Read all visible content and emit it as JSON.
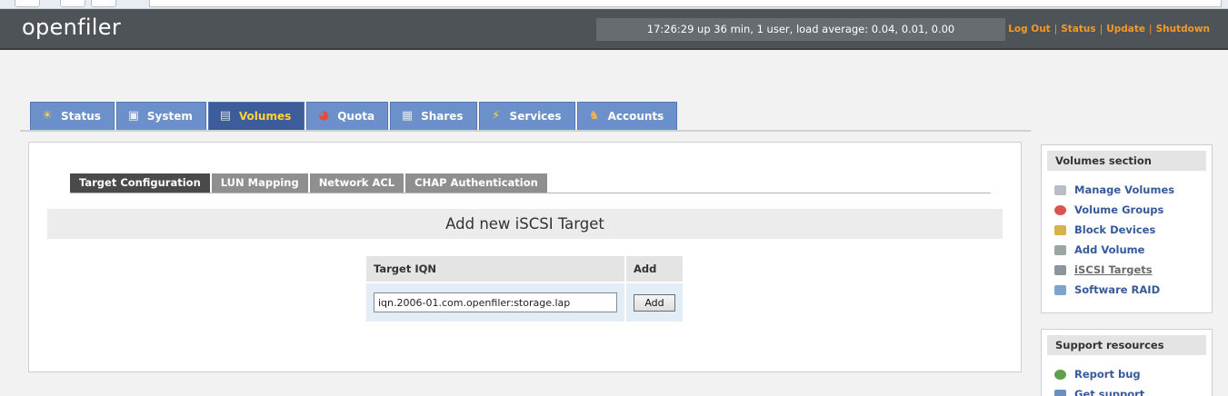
{
  "header": {
    "logo": "openfiler",
    "uptime": "17:26:29 up 36 min, 1 user, load average: 0.04, 0.01, 0.00",
    "links": [
      "Log Out",
      "Status",
      "Update",
      "Shutdown"
    ]
  },
  "tabs": [
    {
      "label": "Status",
      "icon": "sun-icon"
    },
    {
      "label": "System",
      "icon": "monitor-icon"
    },
    {
      "label": "Volumes",
      "icon": "disk-icon",
      "active": true
    },
    {
      "label": "Quota",
      "icon": "pie-icon"
    },
    {
      "label": "Shares",
      "icon": "folder-icon"
    },
    {
      "label": "Services",
      "icon": "lightning-icon"
    },
    {
      "label": "Accounts",
      "icon": "users-icon"
    }
  ],
  "subtabs": [
    "Target Configuration",
    "LUN Mapping",
    "Network ACL",
    "CHAP Authentication"
  ],
  "main": {
    "title": "Add new iSCSI Target",
    "table": {
      "col_iqn": "Target IQN",
      "col_add": "Add",
      "iqn_value": "iqn.2006-01.com.openfiler:storage.lap",
      "add_label": "Add"
    }
  },
  "volumes_section": {
    "title": "Volumes section",
    "items": [
      {
        "label": "Manage Volumes",
        "icon": "manage-volumes-icon"
      },
      {
        "label": "Volume Groups",
        "icon": "volume-groups-icon"
      },
      {
        "label": "Block Devices",
        "icon": "block-devices-icon"
      },
      {
        "label": "Add Volume",
        "icon": "add-volume-icon"
      },
      {
        "label": "iSCSI Targets",
        "icon": "iscsi-targets-icon",
        "current": true
      },
      {
        "label": "Software RAID",
        "icon": "software-raid-icon"
      }
    ]
  },
  "support_section": {
    "title": "Support resources",
    "items": [
      {
        "label": "Report bug",
        "icon": "bug-icon"
      },
      {
        "label": "Get support",
        "icon": "support-icon"
      }
    ]
  },
  "colors": {
    "header_bg": "#4e5357",
    "tab_bg": "#6c90c9",
    "tab_active_bg": "#3d5c9a",
    "tab_active_text": "#ffd33a",
    "link_orange": "#f39a28",
    "sidebar_link": "#355a9b"
  }
}
